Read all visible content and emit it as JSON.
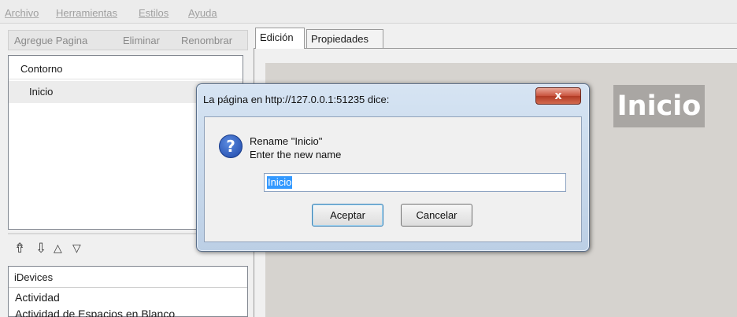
{
  "menubar": {
    "items": [
      {
        "label": "Archivo"
      },
      {
        "label": "Herramientas"
      },
      {
        "label": "Estilos"
      },
      {
        "label": "Ayuda"
      }
    ]
  },
  "left_toolbar": {
    "add_page": "Agregue Pagina",
    "delete": "Eliminar",
    "rename": "Renombrar"
  },
  "outline": {
    "header": "Contorno",
    "items": [
      {
        "label": "Inicio",
        "selected": true
      }
    ]
  },
  "move_controls": [
    "promote-icon",
    "demote-icon",
    "move-up-icon",
    "move-down-icon"
  ],
  "idevices": {
    "header": "iDevices",
    "items": [
      "Actividad",
      "Actividad de Espacios en Blanco"
    ]
  },
  "tabs": [
    {
      "label": "Edición",
      "active": true
    },
    {
      "label": "Propiedades",
      "active": false
    }
  ],
  "content": {
    "heading": "Inicio"
  },
  "dialog": {
    "title": "La página en http://127.0.0.1:51235 dice:",
    "close_symbol": "x",
    "icon": "question-icon",
    "message_line1": "Rename \"Inicio\"",
    "message_line2": "Enter the new name",
    "input_value": "Inicio",
    "ok_label": "Aceptar",
    "cancel_label": "Cancelar"
  }
}
